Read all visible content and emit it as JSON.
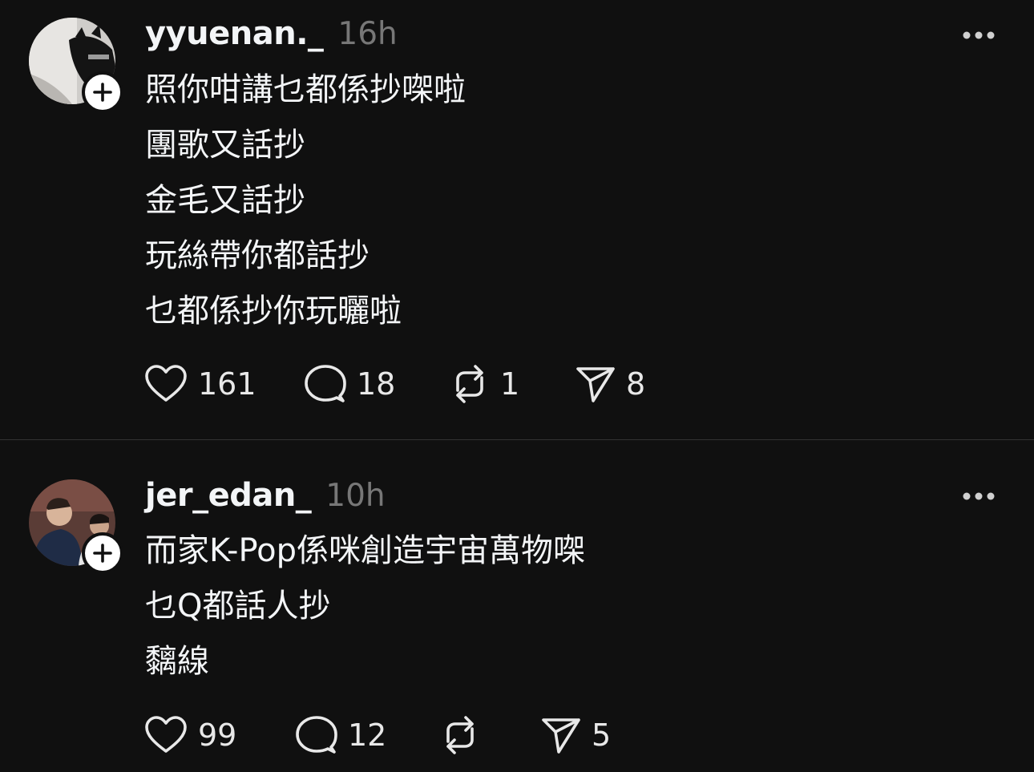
{
  "posts": [
    {
      "username": "yyuenan._",
      "time": "16h",
      "lines": [
        "照你咁講乜都係抄㗎啦",
        "團歌又話抄",
        "金毛又話抄",
        "玩絲帶你都話抄",
        "乜都係抄你玩曬啦"
      ],
      "likes": "161",
      "replies": "18",
      "reposts": "1",
      "shares": "8"
    },
    {
      "username": "jer_edan_",
      "time": "10h",
      "lines": [
        "而家K-Pop係咪創造宇宙萬物㗎",
        "乜Q都話人抄",
        "黐線"
      ],
      "likes": "99",
      "replies": "12",
      "reposts": "",
      "shares": "5"
    }
  ],
  "icons": {
    "like": "heart-icon",
    "reply": "speech-bubble-icon",
    "repost": "repost-arrows-icon",
    "share": "paper-plane-icon",
    "more": "more-dots-icon",
    "follow": "plus-icon"
  },
  "colors": {
    "background": "#101010",
    "text": "#f3f5f7",
    "secondary": "#777777",
    "divider": "#333333"
  }
}
